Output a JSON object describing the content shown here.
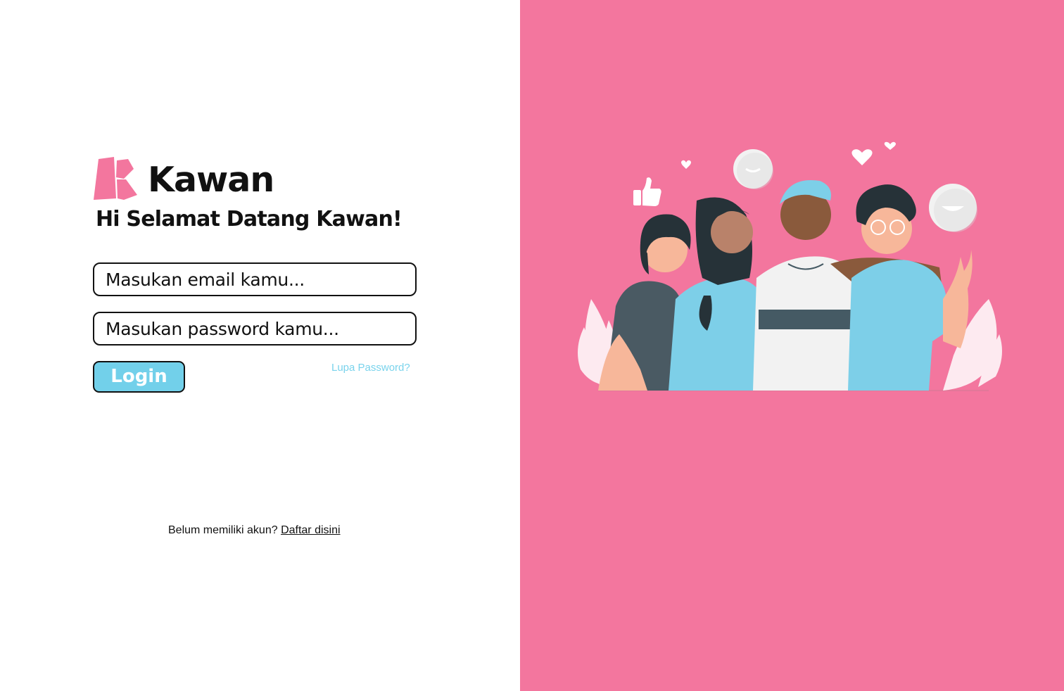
{
  "brand": {
    "name": "Kawan",
    "logo_icon": "kawan-logo-icon",
    "accent_color": "#f3769e"
  },
  "login_form": {
    "welcome_heading": "Hi Selamat Datang Kawan!",
    "email_placeholder": "Masukan email kamu...",
    "password_placeholder": "Masukan password kamu...",
    "login_button": "Login",
    "forgot_password": "Lupa Password?",
    "button_color": "#72d0ea"
  },
  "footer": {
    "no_account_text": "Belum memiliki akun?",
    "register_link": "Daftar disini"
  },
  "hero": {
    "background_color": "#f3769e",
    "illustration_icon": "friends-group-illustration"
  }
}
